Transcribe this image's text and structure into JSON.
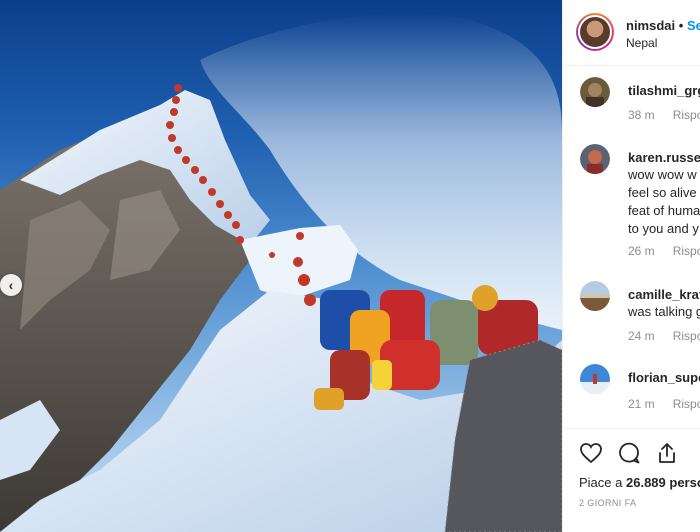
{
  "post": {
    "username": "nimsdai",
    "separator": "•",
    "follow_label": "Se",
    "location": "Nepal"
  },
  "comments": [
    {
      "username": "tilashmi_grg",
      "text": [],
      "time": "38 m",
      "reply": "Rispon"
    },
    {
      "username": "karen.russel",
      "text": [
        "wow wow w",
        "feel so alive",
        "feat of huma",
        "to you and y"
      ],
      "time": "26 m",
      "reply": "Rispon"
    },
    {
      "username": "camille_kraf",
      "text": [
        "was talking g"
      ],
      "time": "24 m",
      "reply": "Rispon"
    },
    {
      "username": "florian_supe",
      "text": [],
      "time": "21 m",
      "reply": "Rispon"
    }
  ],
  "actions": {
    "like_icon": "heart-icon",
    "comment_icon": "comment-bubble-icon",
    "share_icon": "share-icon",
    "likes_prefix": "Piace a",
    "likes_count": "26.889",
    "likes_suffix": "perso",
    "date": "2 GIORNI FA"
  },
  "nav": {
    "prev_icon": "chevron-left-icon"
  }
}
